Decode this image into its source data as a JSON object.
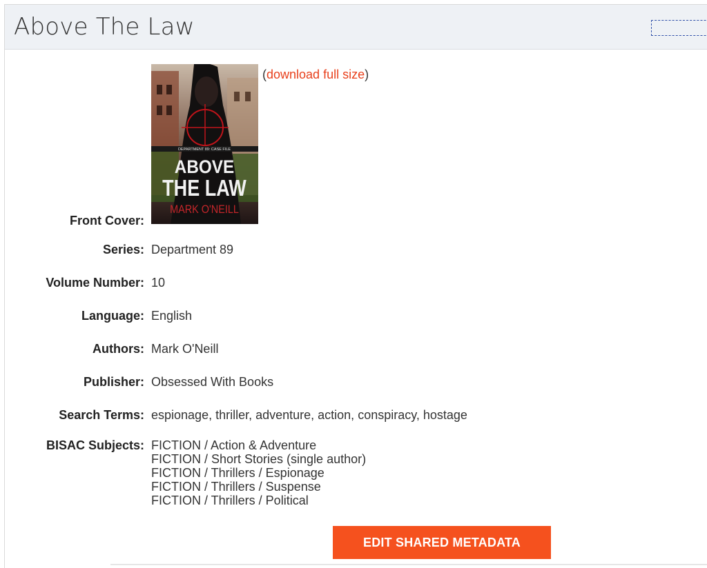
{
  "panel": {
    "title": "Above The Law"
  },
  "cover": {
    "label": "Front Cover:",
    "download_prefix": "(",
    "download_link": "download full size",
    "download_suffix": ")",
    "image_text": {
      "series_tag": "DEPARTMENT 89: CASE FILE",
      "title_line1": "ABOVE",
      "title_line2": "THE LAW",
      "author": "MARK O'NEILL"
    }
  },
  "fields": {
    "series": {
      "label": "Series:",
      "value": "Department 89"
    },
    "volume": {
      "label": "Volume Number:",
      "value": "10"
    },
    "language": {
      "label": "Language:",
      "value": "English"
    },
    "authors": {
      "label": "Authors:",
      "value": "Mark O'Neill"
    },
    "publisher": {
      "label": "Publisher:",
      "value": "Obsessed With Books"
    },
    "search_terms": {
      "label": "Search Terms:",
      "value": "espionage, thriller, adventure, action, conspiracy, hostage"
    },
    "bisac": {
      "label": "BISAC Subjects:",
      "values": [
        "FICTION / Action & Adventure",
        "FICTION / Short Stories (single author)",
        "FICTION / Thrillers / Espionage",
        "FICTION / Thrillers / Suspense",
        "FICTION / Thrillers / Political"
      ]
    }
  },
  "actions": {
    "edit_label": "EDIT SHARED METADATA"
  },
  "colors": {
    "accent": "#f5511e",
    "link": "#e8401c",
    "header_bg": "#eef1f5"
  }
}
